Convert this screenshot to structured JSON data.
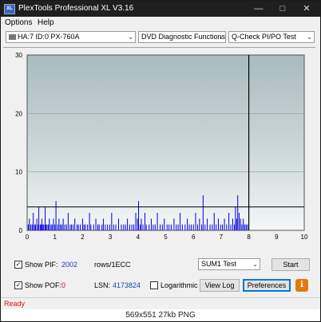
{
  "window": {
    "title": "PlexTools Professional XL V3.16",
    "icon_label": "XL"
  },
  "menu": {
    "items": [
      "Options",
      "Help"
    ]
  },
  "toolbar": {
    "drive": "HA:7 ID:0  PX-760A",
    "function": "DVD Diagnostic Functions",
    "test": "Q-Check PI/PO Test"
  },
  "chart_data": {
    "type": "bar",
    "title": "",
    "xlabel": "",
    "ylabel": "",
    "xlim": [
      0,
      10
    ],
    "ylim": [
      0,
      30
    ],
    "x_ticks": [
      "0",
      "1",
      "2",
      "3",
      "4",
      "5",
      "6",
      "7",
      "8",
      "9",
      "10"
    ],
    "y_ticks": [
      "0",
      "10",
      "20",
      "30"
    ],
    "threshold": 4,
    "end_marker": 8,
    "bar_color": "#0000e0",
    "x": [
      0.04,
      0.08,
      0.13,
      0.18,
      0.22,
      0.27,
      0.3,
      0.35,
      0.4,
      0.42,
      0.47,
      0.5,
      0.53,
      0.57,
      0.6,
      0.65,
      0.68,
      0.72,
      0.77,
      0.8,
      0.86,
      0.9,
      0.95,
      1.0,
      1.04,
      1.1,
      1.15,
      1.2,
      1.25,
      1.3,
      1.36,
      1.42,
      1.48,
      1.55,
      1.6,
      1.66,
      1.72,
      1.8,
      1.85,
      1.92,
      2.0,
      2.05,
      2.1,
      2.18,
      2.25,
      2.3,
      2.4,
      2.48,
      2.55,
      2.6,
      2.7,
      2.75,
      2.82,
      2.9,
      2.98,
      3.05,
      3.12,
      3.2,
      3.3,
      3.4,
      3.48,
      3.55,
      3.62,
      3.7,
      3.78,
      3.85,
      3.92,
      3.98,
      4.02,
      4.08,
      4.12,
      4.18,
      4.25,
      4.3,
      4.4,
      4.48,
      4.55,
      4.62,
      4.7,
      4.8,
      4.88,
      4.95,
      5.05,
      5.12,
      5.2,
      5.3,
      5.38,
      5.45,
      5.52,
      5.6,
      5.7,
      5.78,
      5.85,
      5.92,
      6.0,
      6.08,
      6.15,
      6.22,
      6.3,
      6.35,
      6.42,
      6.5,
      6.6,
      6.68,
      6.75,
      6.82,
      6.9,
      6.98,
      7.05,
      7.12,
      7.2,
      7.28,
      7.35,
      7.42,
      7.48,
      7.52,
      7.56,
      7.6,
      7.65,
      7.7,
      7.75,
      7.8,
      7.85,
      7.9,
      7.95
    ],
    "values": [
      1,
      2,
      1,
      1,
      3,
      1,
      1,
      2,
      1,
      4,
      1,
      1,
      2,
      1,
      1,
      4,
      1,
      1,
      1,
      2,
      1,
      1,
      2,
      1,
      5,
      1,
      2,
      1,
      1,
      2,
      1,
      1,
      3,
      1,
      1,
      1,
      2,
      1,
      1,
      1,
      2,
      1,
      1,
      1,
      3,
      1,
      1,
      2,
      1,
      1,
      1,
      2,
      1,
      1,
      1,
      3,
      1,
      1,
      2,
      1,
      1,
      1,
      2,
      1,
      1,
      1,
      3,
      2,
      5,
      1,
      2,
      1,
      3,
      1,
      1,
      2,
      1,
      1,
      3,
      1,
      1,
      2,
      1,
      1,
      1,
      2,
      1,
      1,
      3,
      1,
      1,
      2,
      1,
      1,
      1,
      3,
      1,
      2,
      1,
      6,
      1,
      2,
      1,
      1,
      3,
      1,
      2,
      1,
      1,
      2,
      1,
      3,
      1,
      2,
      1,
      4,
      2,
      6,
      3,
      2,
      1,
      2,
      1,
      1,
      1
    ]
  },
  "controls": {
    "show_pif": {
      "label": "Show PIF:",
      "value": "2002",
      "checked": "✓"
    },
    "show_pof": {
      "label": "Show POF:",
      "value": "0",
      "checked": "✓"
    },
    "rows_label": "rows/1ECC",
    "lsn_label": "LSN:",
    "lsn_value": "4173824",
    "logarithmic_label": "Logarithmic",
    "sum_select": "SUM1 Test",
    "start_label": "Start",
    "view_log_label": "View Log",
    "preferences_label": "Preferences",
    "info_label": "i"
  },
  "status": {
    "text": "Ready"
  },
  "caption": "569x551  27kb  PNG"
}
